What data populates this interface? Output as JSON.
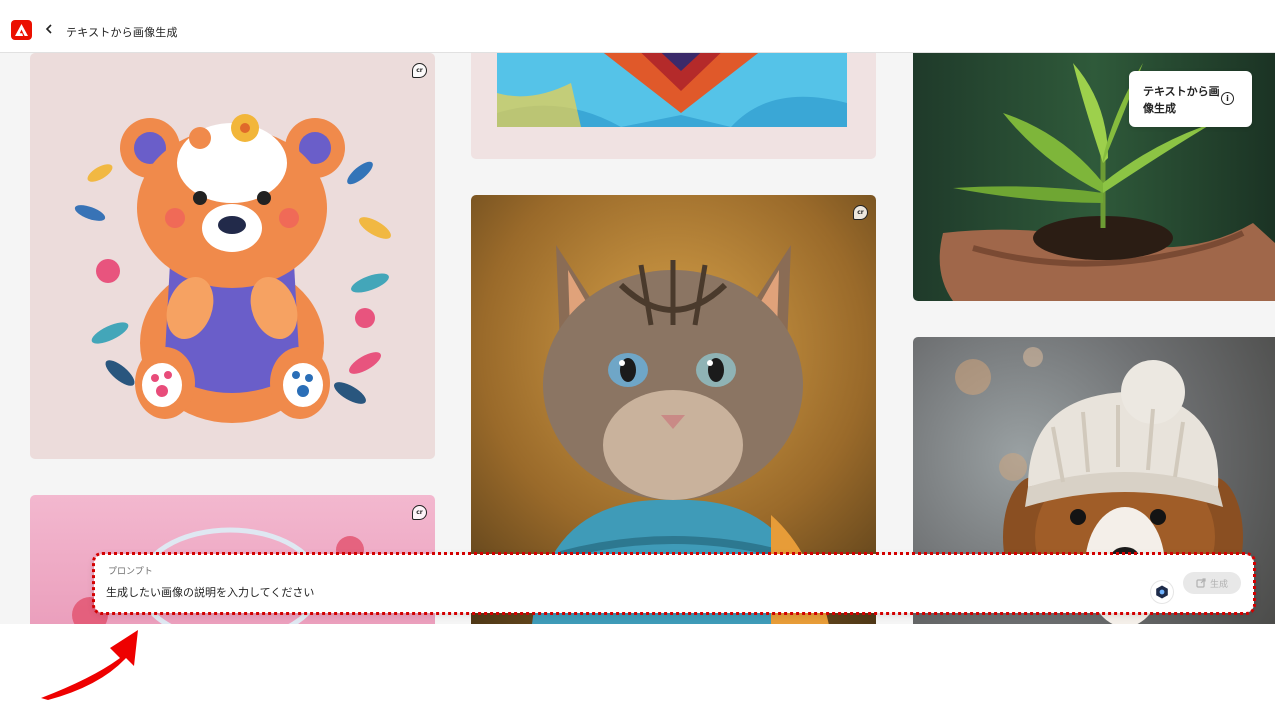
{
  "header": {
    "title": "テキストから画像生成",
    "logo_icon": "adobe-logo",
    "back_icon": "chevron-left-icon"
  },
  "gallery": {
    "badge_text": "cr",
    "cards": [
      {
        "name": "teddy-bear-flowers",
        "badge": true
      },
      {
        "name": "pink-neon-ring",
        "badge": true
      },
      {
        "name": "abstract-paint-heart",
        "badge": false
      },
      {
        "name": "kitten-sweater",
        "badge": true
      },
      {
        "name": "plant-in-hand",
        "badge": false
      },
      {
        "name": "puppy-beanie",
        "badge": false
      }
    ]
  },
  "tooltip": {
    "text": "テキストから画像生成",
    "info_icon": "info-icon"
  },
  "prompt": {
    "label": "プロンプト",
    "placeholder": "生成したい画像の説明を入力してください",
    "value": "",
    "generate_label": "生成",
    "style_icon": "hexagon-style-icon",
    "generate_icon": "generate-icon"
  },
  "annotation": {
    "arrow_color": "#ee0000",
    "outline_color": "#d40000"
  }
}
